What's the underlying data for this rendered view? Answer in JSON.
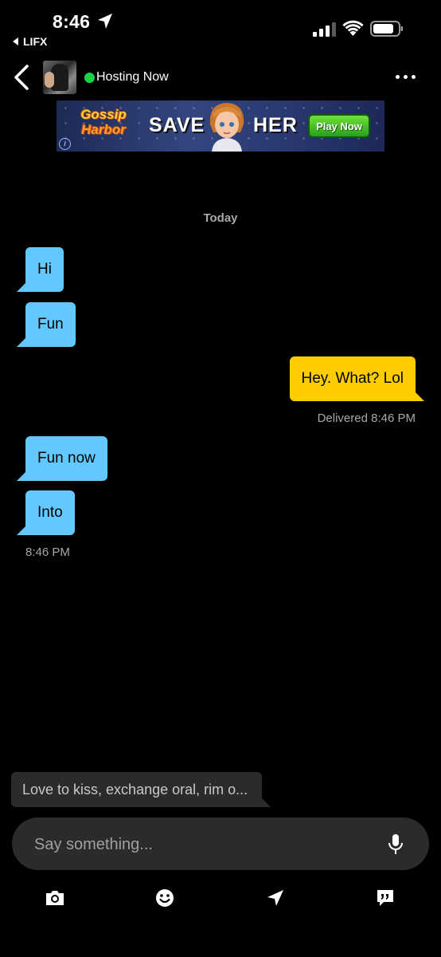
{
  "status_bar": {
    "time": "8:46",
    "back_app": "LIFX"
  },
  "header": {
    "status_text": "Hosting Now",
    "status_color": "#1bd24b"
  },
  "ad": {
    "logo_line1": "Gossip",
    "logo_line2": "Harbor",
    "word1": "SAVE",
    "word2": "HER",
    "cta": "Play Now",
    "info": "i"
  },
  "chat": {
    "date_label": "Today",
    "messages": [
      {
        "direction": "in",
        "text": "Hi"
      },
      {
        "direction": "in",
        "text": "Fun"
      },
      {
        "direction": "out",
        "text": "Hey. What? Lol"
      },
      {
        "direction": "in",
        "text": "Fun now"
      },
      {
        "direction": "in",
        "text": "Into"
      }
    ],
    "delivered_label": "Delivered",
    "delivered_time": "8:46 PM",
    "received_time": "8:46 PM"
  },
  "suggestion": {
    "text": "Love to kiss, exchange oral, rim o..."
  },
  "composer": {
    "placeholder": "Say something..."
  },
  "toolbar": {
    "icons": [
      "camera-icon",
      "emoji-icon",
      "location-icon",
      "saved-phrases-icon"
    ]
  },
  "colors": {
    "incoming_bubble": "#62c9ff",
    "outgoing_bubble": "#ffcc00",
    "background": "#000000"
  }
}
